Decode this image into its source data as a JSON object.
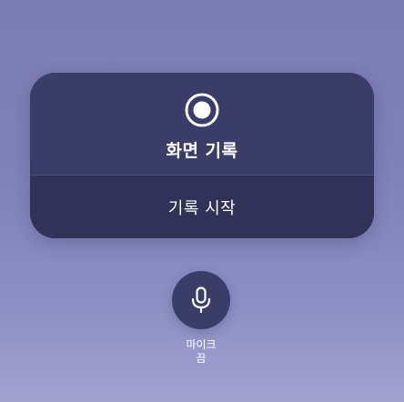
{
  "screen_record": {
    "icon": "record-icon",
    "title": "화면 기록",
    "start_label": "기록 시작"
  },
  "microphone": {
    "icon": "microphone-icon",
    "label_line1": "마이크",
    "label_line2": "끔"
  },
  "colors": {
    "panel": "#3b3d69",
    "panel_bottom": "#313258",
    "background": "#7e80b8",
    "text": "#ffffff"
  }
}
